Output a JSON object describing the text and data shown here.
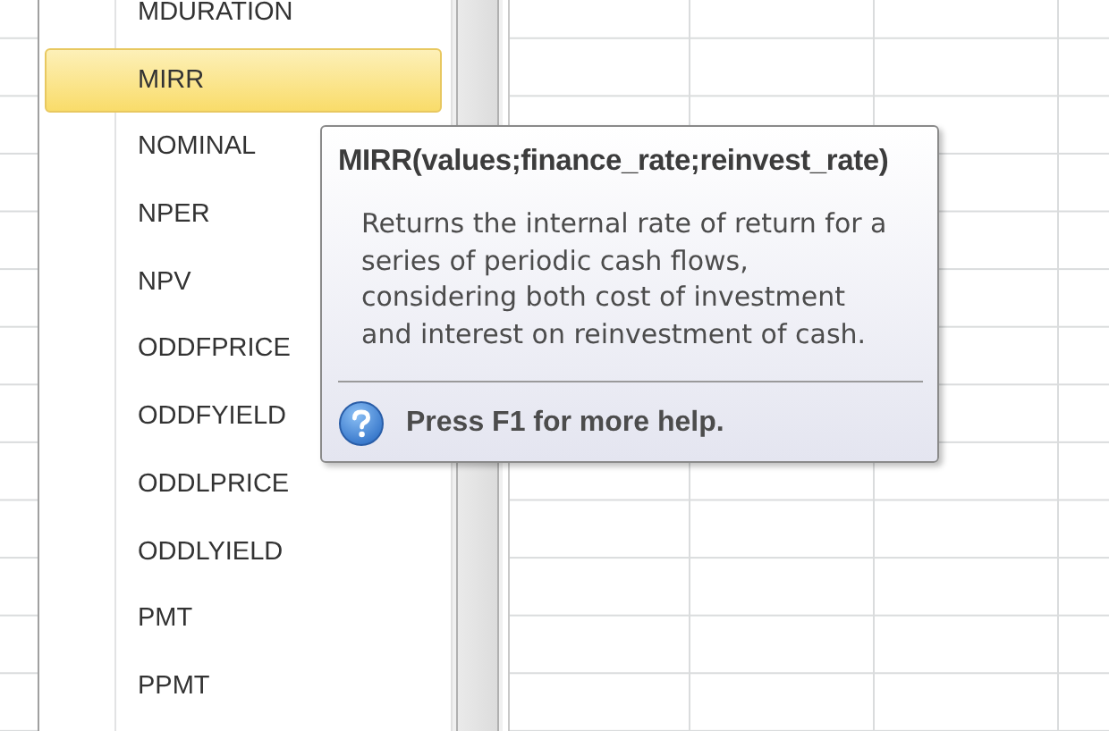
{
  "function_list": {
    "items": [
      {
        "label": "MDURATION",
        "selected": false
      },
      {
        "label": "MIRR",
        "selected": true
      },
      {
        "label": "NOMINAL",
        "selected": false
      },
      {
        "label": "NPER",
        "selected": false
      },
      {
        "label": "NPV",
        "selected": false
      },
      {
        "label": "ODDFPRICE",
        "selected": false
      },
      {
        "label": "ODDFYIELD",
        "selected": false
      },
      {
        "label": "ODDLPRICE",
        "selected": false
      },
      {
        "label": "ODDLYIELD",
        "selected": false
      },
      {
        "label": "PMT",
        "selected": false
      },
      {
        "label": "PPMT",
        "selected": false
      }
    ]
  },
  "tooltip": {
    "signature": "MIRR(values;finance_rate;reinvest_rate)",
    "description": "Returns the internal rate of return for a series of periodic cash flows, considering both cost of investment and interest on reinvestment of cash.",
    "help": "Press F1 for more help."
  }
}
